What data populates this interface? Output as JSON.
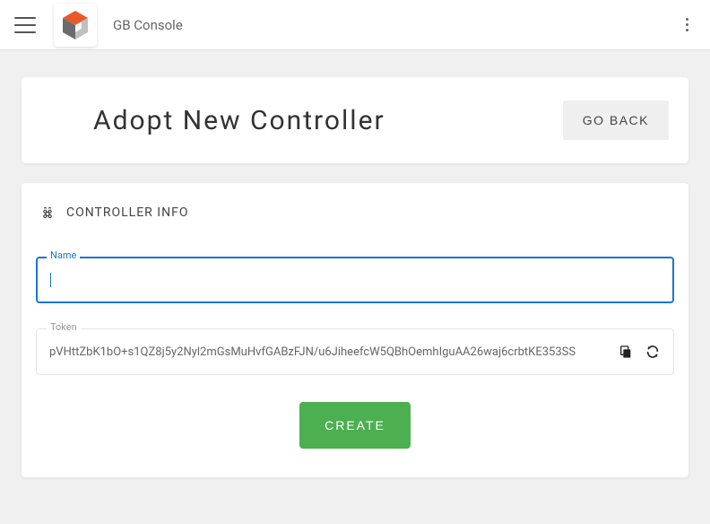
{
  "app": {
    "title": "GB Console"
  },
  "header": {
    "title": "Adopt New Controller",
    "go_back_label": "GO BACK"
  },
  "form": {
    "section_title": "CONTROLLER INFO",
    "name_label": "Name",
    "name_value": "",
    "token_label": "Token",
    "token_value": "pVHttZbK1bO+s1QZ8j5y2Nyl2mGsMuHvfGABzFJN/u6JiheefcW5QBhOemhIguAA26waj6crbtKE353SS",
    "create_label": "CREATE"
  }
}
